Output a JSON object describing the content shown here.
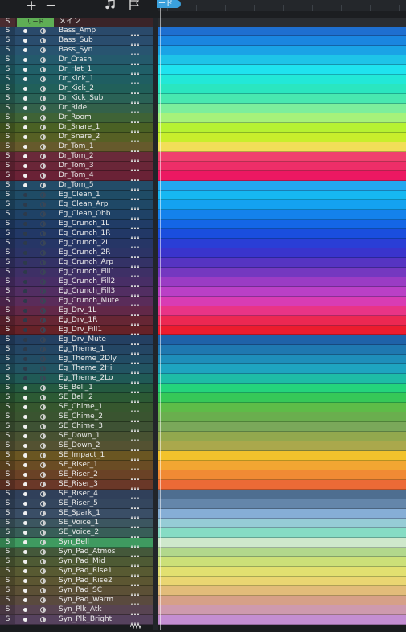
{
  "toolbar": {
    "add_label": "+",
    "remove_label": "−",
    "note_icon": "music-note-icon",
    "flag_icon": "flag-icon"
  },
  "ruler": {
    "marker_label": "ード"
  },
  "header": {
    "s_label": "S",
    "lead_label": "リード",
    "main_label": "メイン"
  },
  "tracks": [
    {
      "name": "Bass_Amp",
      "color": "#1e6fd0",
      "panel": "#2a4a6b",
      "dim": false
    },
    {
      "name": "Bass_Sub",
      "color": "#1a86e0",
      "panel": "#2a4d6e",
      "dim": false
    },
    {
      "name": "Bass_Syn",
      "color": "#1aa3e6",
      "panel": "#285470",
      "dim": false
    },
    {
      "name": "Dr_Crash",
      "color": "#1ec4e8",
      "panel": "#245a6c",
      "dim": false
    },
    {
      "name": "Dr_Hat_1",
      "color": "#1fe3ef",
      "panel": "#205f68",
      "dim": false
    },
    {
      "name": "Dr_Kick_1",
      "color": "#22e8d8",
      "panel": "#1f5e62",
      "dim": false
    },
    {
      "name": "Dr_Kick_2",
      "color": "#2ae6c0",
      "panel": "#21605a",
      "dim": false
    },
    {
      "name": "Dr_Kick_Sub",
      "color": "#48e8b0",
      "panel": "#2a6256",
      "dim": false
    },
    {
      "name": "Dr_Ride",
      "color": "#7cee9c",
      "panel": "#33614a",
      "dim": false
    },
    {
      "name": "Dr_Room",
      "color": "#a6f27a",
      "panel": "#3f6336",
      "dim": false
    },
    {
      "name": "Dr_Snare_1",
      "color": "#b6f232",
      "panel": "#4a6124",
      "dim": false
    },
    {
      "name": "Dr_Snare_2",
      "color": "#c8ee2c",
      "panel": "#566024",
      "dim": false
    },
    {
      "name": "Dr_Tom_1",
      "color": "#f2de58",
      "panel": "#665a2c",
      "dim": false
    },
    {
      "name": "Dr_Tom_2",
      "color": "#f0406e",
      "panel": "#6a2a3a",
      "dim": false
    },
    {
      "name": "Dr_Tom_3",
      "color": "#ee2e68",
      "panel": "#6a2638",
      "dim": false
    },
    {
      "name": "Dr_Tom_4",
      "color": "#ec1862",
      "panel": "#6a2236",
      "dim": false
    },
    {
      "name": "Dr_Tom_5",
      "color": "#23a8f0",
      "panel": "#234c68",
      "dim": false
    },
    {
      "name": "Eg_Clean_1",
      "color": "#16b8f2",
      "panel": "#1f4c66",
      "dim": true
    },
    {
      "name": "Eg_Clean_Arp",
      "color": "#14a2f0",
      "panel": "#1f4866",
      "dim": true
    },
    {
      "name": "Eg_Clean_Obb",
      "color": "#1482ec",
      "panel": "#1f4266",
      "dim": true
    },
    {
      "name": "Eg_Crunch_1L",
      "color": "#1466e6",
      "panel": "#203c66",
      "dim": true
    },
    {
      "name": "Eg_Crunch_1R",
      "color": "#1a4ede",
      "panel": "#223866",
      "dim": true
    },
    {
      "name": "Eg_Crunch_2L",
      "color": "#2a3ed6",
      "panel": "#263666",
      "dim": true
    },
    {
      "name": "Eg_Crunch_2R",
      "color": "#3a34cc",
      "panel": "#2c3466",
      "dim": true
    },
    {
      "name": "Eg_Crunch_Arp",
      "color": "#5634c2",
      "panel": "#343266",
      "dim": true
    },
    {
      "name": "Eg_Crunch_Fill1",
      "color": "#7438c0",
      "panel": "#3e3066",
      "dim": true
    },
    {
      "name": "Eg_Crunch_Fill2",
      "color": "#9a3cc4",
      "panel": "#482e66",
      "dim": true
    },
    {
      "name": "Eg_Crunch_Fill3",
      "color": "#ba40c6",
      "panel": "#522e62",
      "dim": true
    },
    {
      "name": "Eg_Crunch_Mute",
      "color": "#d83cb4",
      "panel": "#5a2c5a",
      "dim": true
    },
    {
      "name": "Eg_Drv_1L",
      "color": "#e83486",
      "panel": "#622848",
      "dim": true
    },
    {
      "name": "Eg_Drv_1R",
      "color": "#ec2852",
      "panel": "#662634",
      "dim": true
    },
    {
      "name": "Eg_Drv_Fill1",
      "color": "#ec1c2e",
      "panel": "#662228",
      "dim": true
    },
    {
      "name": "Eg_Drv_Mute",
      "color": "#1f62a8",
      "panel": "#244062",
      "dim": true
    },
    {
      "name": "Eg_Theme_1",
      "color": "#1f78b0",
      "panel": "#244664",
      "dim": true
    },
    {
      "name": "Eg_Theme_2Dly",
      "color": "#1e8eba",
      "panel": "#224c64",
      "dim": true
    },
    {
      "name": "Eg_Theme_2Hi",
      "color": "#1ea4c0",
      "panel": "#225462",
      "dim": true
    },
    {
      "name": "Eg_Theme_2Lo",
      "color": "#1ebca6",
      "panel": "#205a56",
      "dim": true
    },
    {
      "name": "SE_Bell_1",
      "color": "#24d47c",
      "panel": "#245a40",
      "dim": false
    },
    {
      "name": "SE_Bell_2",
      "color": "#36c858",
      "panel": "#2c5a34",
      "dim": false
    },
    {
      "name": "SE_Chime_1",
      "color": "#5ebc48",
      "panel": "#36572e",
      "dim": false
    },
    {
      "name": "SE_Chime_2",
      "color": "#6aae4e",
      "panel": "#3a5430",
      "dim": false
    },
    {
      "name": "SE_Chime_3",
      "color": "#7aa85a",
      "panel": "#3e5234",
      "dim": false
    },
    {
      "name": "SE_Down_1",
      "color": "#92a84e",
      "panel": "#485232",
      "dim": false
    },
    {
      "name": "SE_Down_2",
      "color": "#aaa84c",
      "panel": "#545232",
      "dim": false
    },
    {
      "name": "SE_Impact_1",
      "color": "#f2c22c",
      "panel": "#6a5622",
      "dim": false
    },
    {
      "name": "SE_Riser_1",
      "color": "#f2a632",
      "panel": "#6a4c24",
      "dim": false
    },
    {
      "name": "SE_Riser_2",
      "color": "#f08a34",
      "panel": "#6a4226",
      "dim": false
    },
    {
      "name": "SE_Riser_3",
      "color": "#ec6a36",
      "panel": "#6a3828",
      "dim": false
    },
    {
      "name": "SE_Riser_4",
      "color": "#4e6e90",
      "panel": "#30405a",
      "dim": false
    },
    {
      "name": "SE_Riser_5",
      "color": "#6486aa",
      "panel": "#34465e",
      "dim": false
    },
    {
      "name": "SE_Spark_1",
      "color": "#86aed6",
      "panel": "#3a4e66",
      "dim": false
    },
    {
      "name": "SE_Voice_1",
      "color": "#96ccd6",
      "panel": "#3c5660",
      "dim": false
    },
    {
      "name": "SE_Voice_2",
      "color": "#86dcc4",
      "panel": "#385e58",
      "dim": false
    },
    {
      "name": "Syn_Bell",
      "color": "#cfe8cc",
      "panel": "#3f9a60",
      "dim": false
    },
    {
      "name": "Syn_Pad_Atmos",
      "color": "#b2d88c",
      "panel": "#44583a",
      "dim": false
    },
    {
      "name": "Syn_Pad_Mid",
      "color": "#cce078",
      "panel": "#4e5a34",
      "dim": false
    },
    {
      "name": "Syn_Pad_Rise1",
      "color": "#e2e070",
      "panel": "#585a32",
      "dim": false
    },
    {
      "name": "Syn_Pad_Rise2",
      "color": "#ead672",
      "panel": "#5c5632",
      "dim": false
    },
    {
      "name": "Syn_Pad_SC",
      "color": "#e2bc7a",
      "panel": "#5c5036",
      "dim": false
    },
    {
      "name": "Syn_Pad_Warm",
      "color": "#d6a088",
      "panel": "#5a4a3e",
      "dim": false
    },
    {
      "name": "Syn_Plk_Atk",
      "color": "#ce9aae",
      "panel": "#584452",
      "dim": false
    },
    {
      "name": "Syn_Plk_Bright",
      "color": "#c48ed2",
      "panel": "#56425e",
      "dim": false
    }
  ],
  "labels": {
    "solo": "S"
  },
  "colors": {
    "playhead": "#ffffff",
    "marker": "#3aa0dc"
  }
}
